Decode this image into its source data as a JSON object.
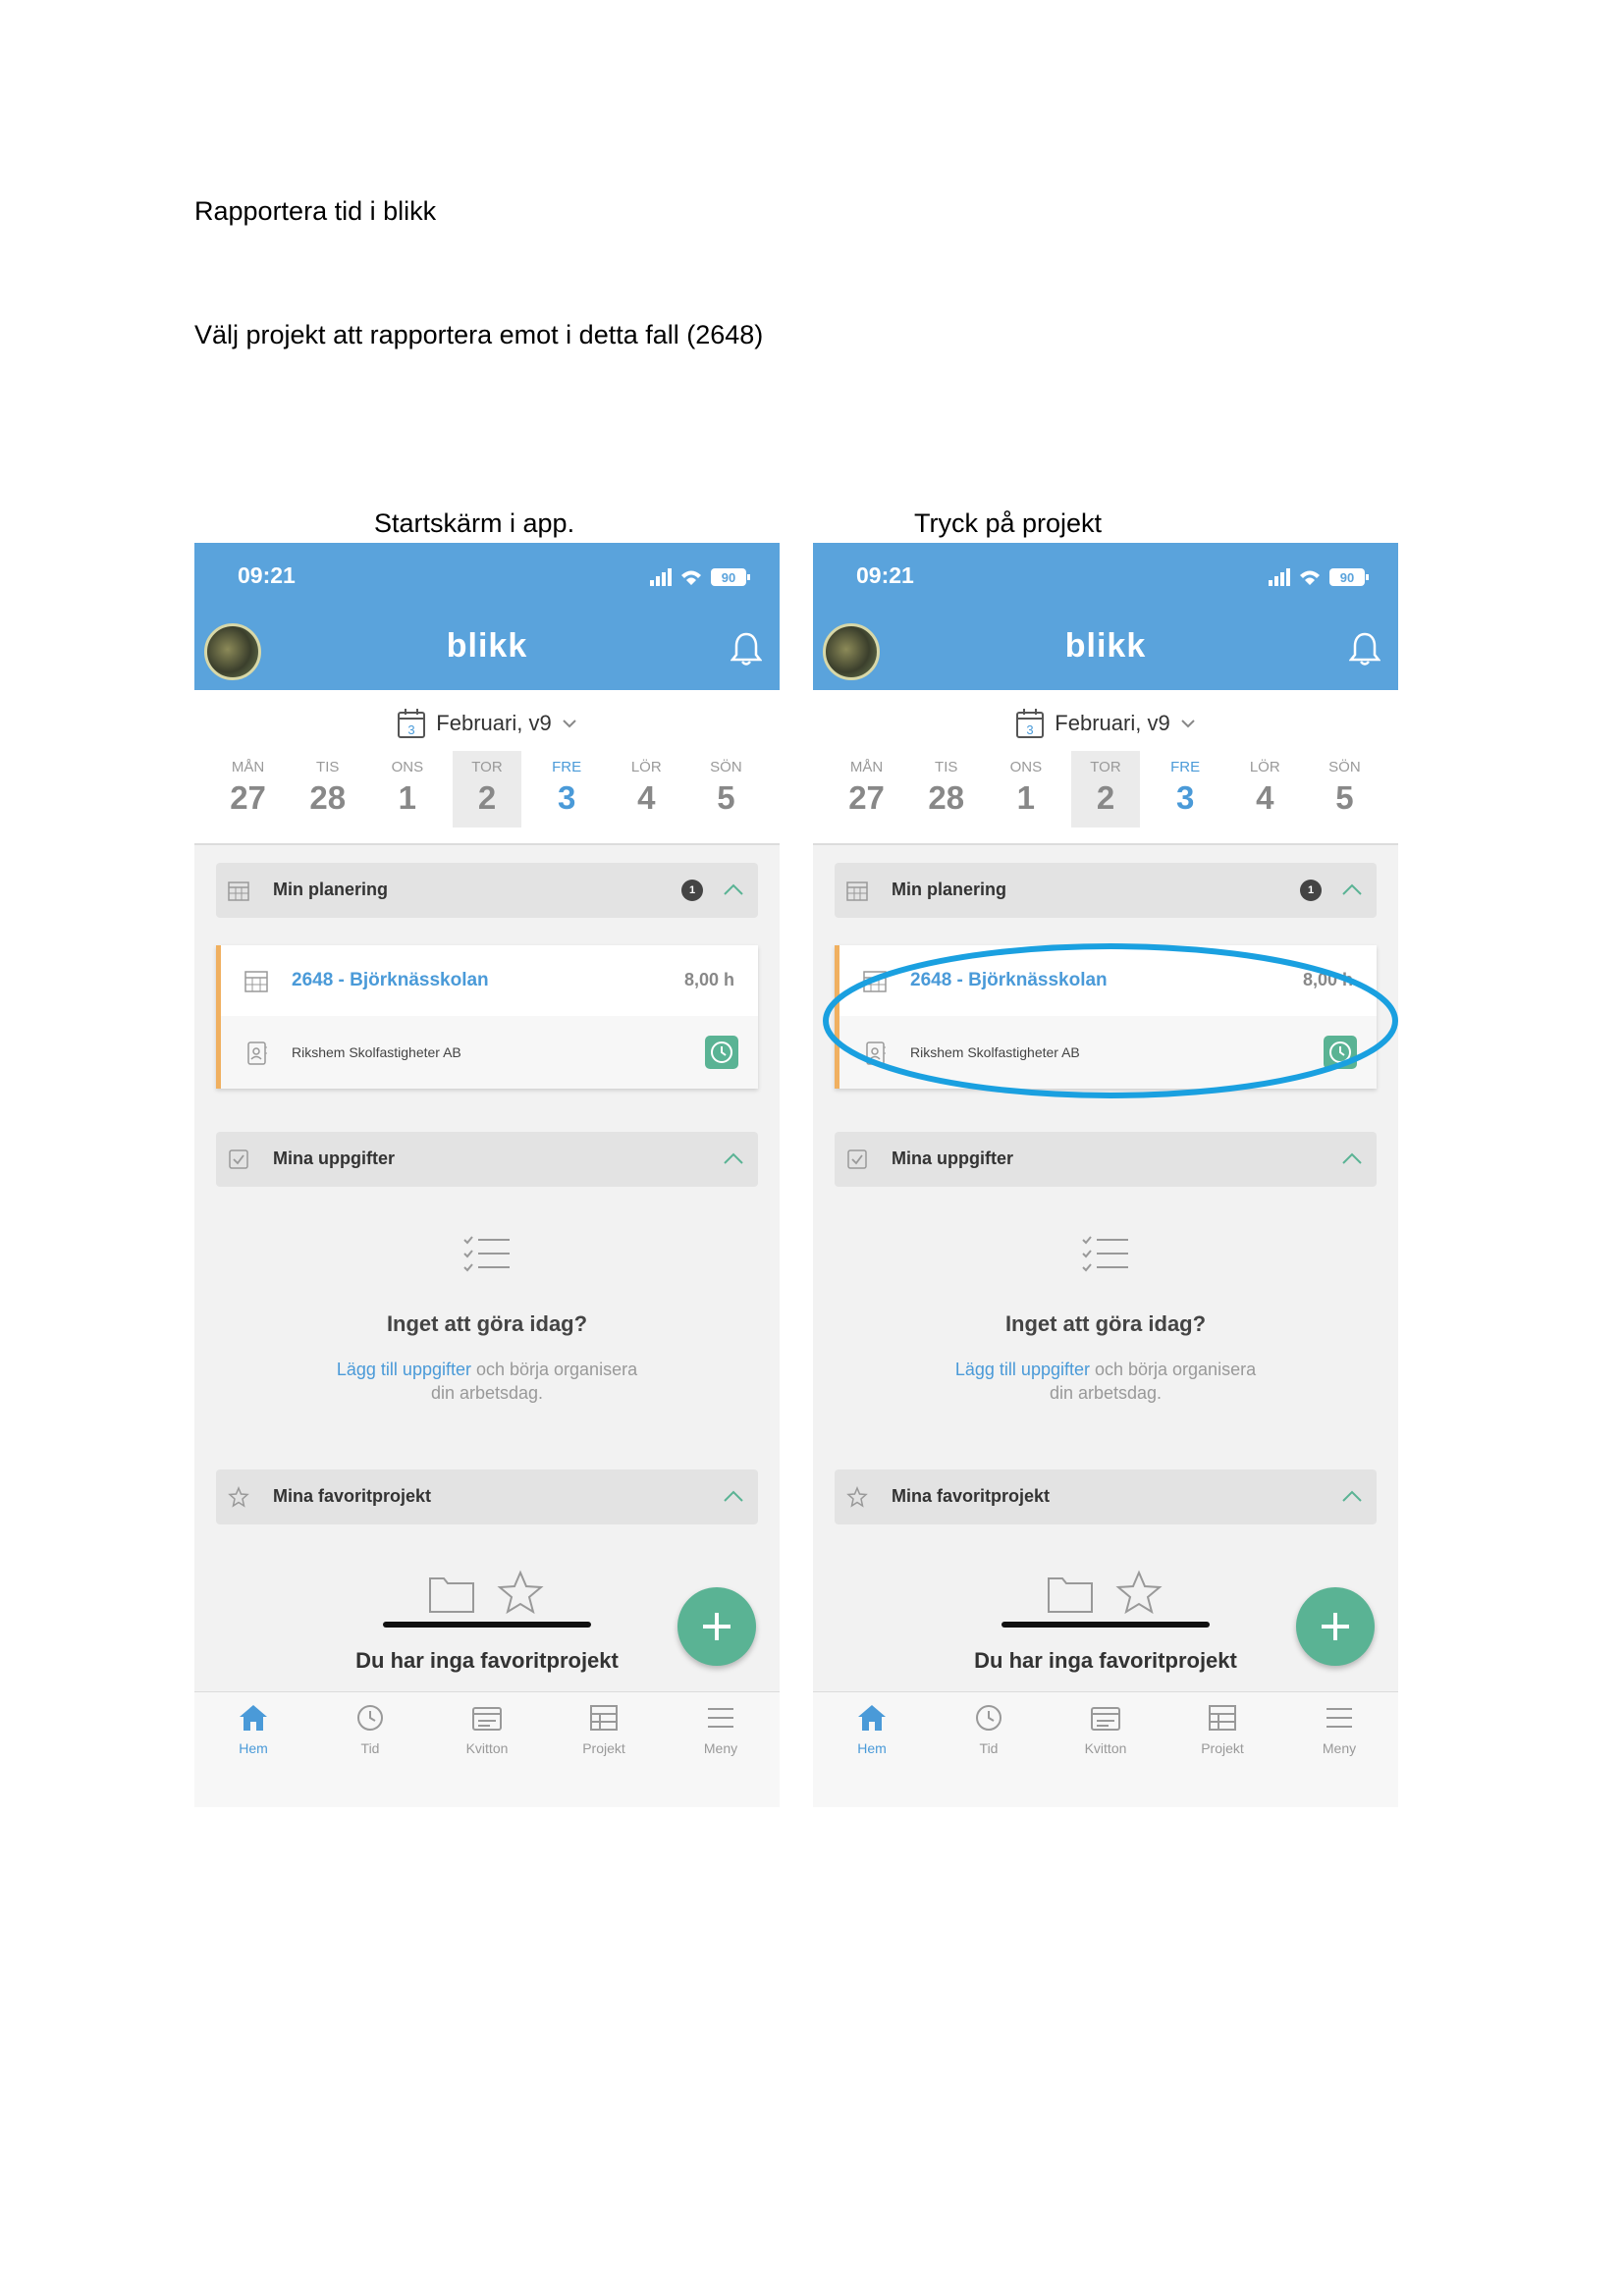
{
  "document": {
    "title": "Rapportera tid i blikk",
    "instruction": "Välj projekt att rapportera emot i detta fall (2648)"
  },
  "captions": {
    "left": "Startskärm i app.",
    "right": "Tryck på projekt"
  },
  "app": {
    "status_time": "09:21",
    "battery": "90",
    "logo": "blikk",
    "calendar_icon_number": "3",
    "month_label": "Februari, v9",
    "days": [
      {
        "name": "MÅN",
        "num": "27"
      },
      {
        "name": "TIS",
        "num": "28"
      },
      {
        "name": "ONS",
        "num": "1"
      },
      {
        "name": "TOR",
        "num": "2"
      },
      {
        "name": "FRE",
        "num": "3"
      },
      {
        "name": "LÖR",
        "num": "4"
      },
      {
        "name": "SÖN",
        "num": "5"
      }
    ],
    "selected_day": "TOR",
    "today": "FRE",
    "planning": {
      "title": "Min planering",
      "count": "1",
      "project": "2648 - Björknässkolan",
      "hours": "8,00 h",
      "customer": "Rikshem Skolfastigheter AB"
    },
    "tasks": {
      "title": "Mina uppgifter",
      "empty_title": "Inget att göra idag?",
      "empty_link": "Lägg till uppgifter",
      "empty_text_1": " och börja organisera",
      "empty_text_2": "din arbetsdag."
    },
    "favorites": {
      "title": "Mina favoritprojekt",
      "empty_title": "Du har inga favoritprojekt"
    },
    "tabs": [
      {
        "label": "Hem",
        "icon": "home-icon"
      },
      {
        "label": "Tid",
        "icon": "clock-icon"
      },
      {
        "label": "Kvitton",
        "icon": "receipt-icon"
      },
      {
        "label": "Projekt",
        "icon": "table-icon"
      },
      {
        "label": "Meny",
        "icon": "menu-icon"
      }
    ],
    "active_tab": "Hem"
  },
  "colors": {
    "header_blue": "#5aa3dc",
    "accent_blue": "#4a9ad8",
    "green": "#5ab394",
    "card_stripe": "#f0b060",
    "highlight_ring": "#1aa0e0"
  }
}
